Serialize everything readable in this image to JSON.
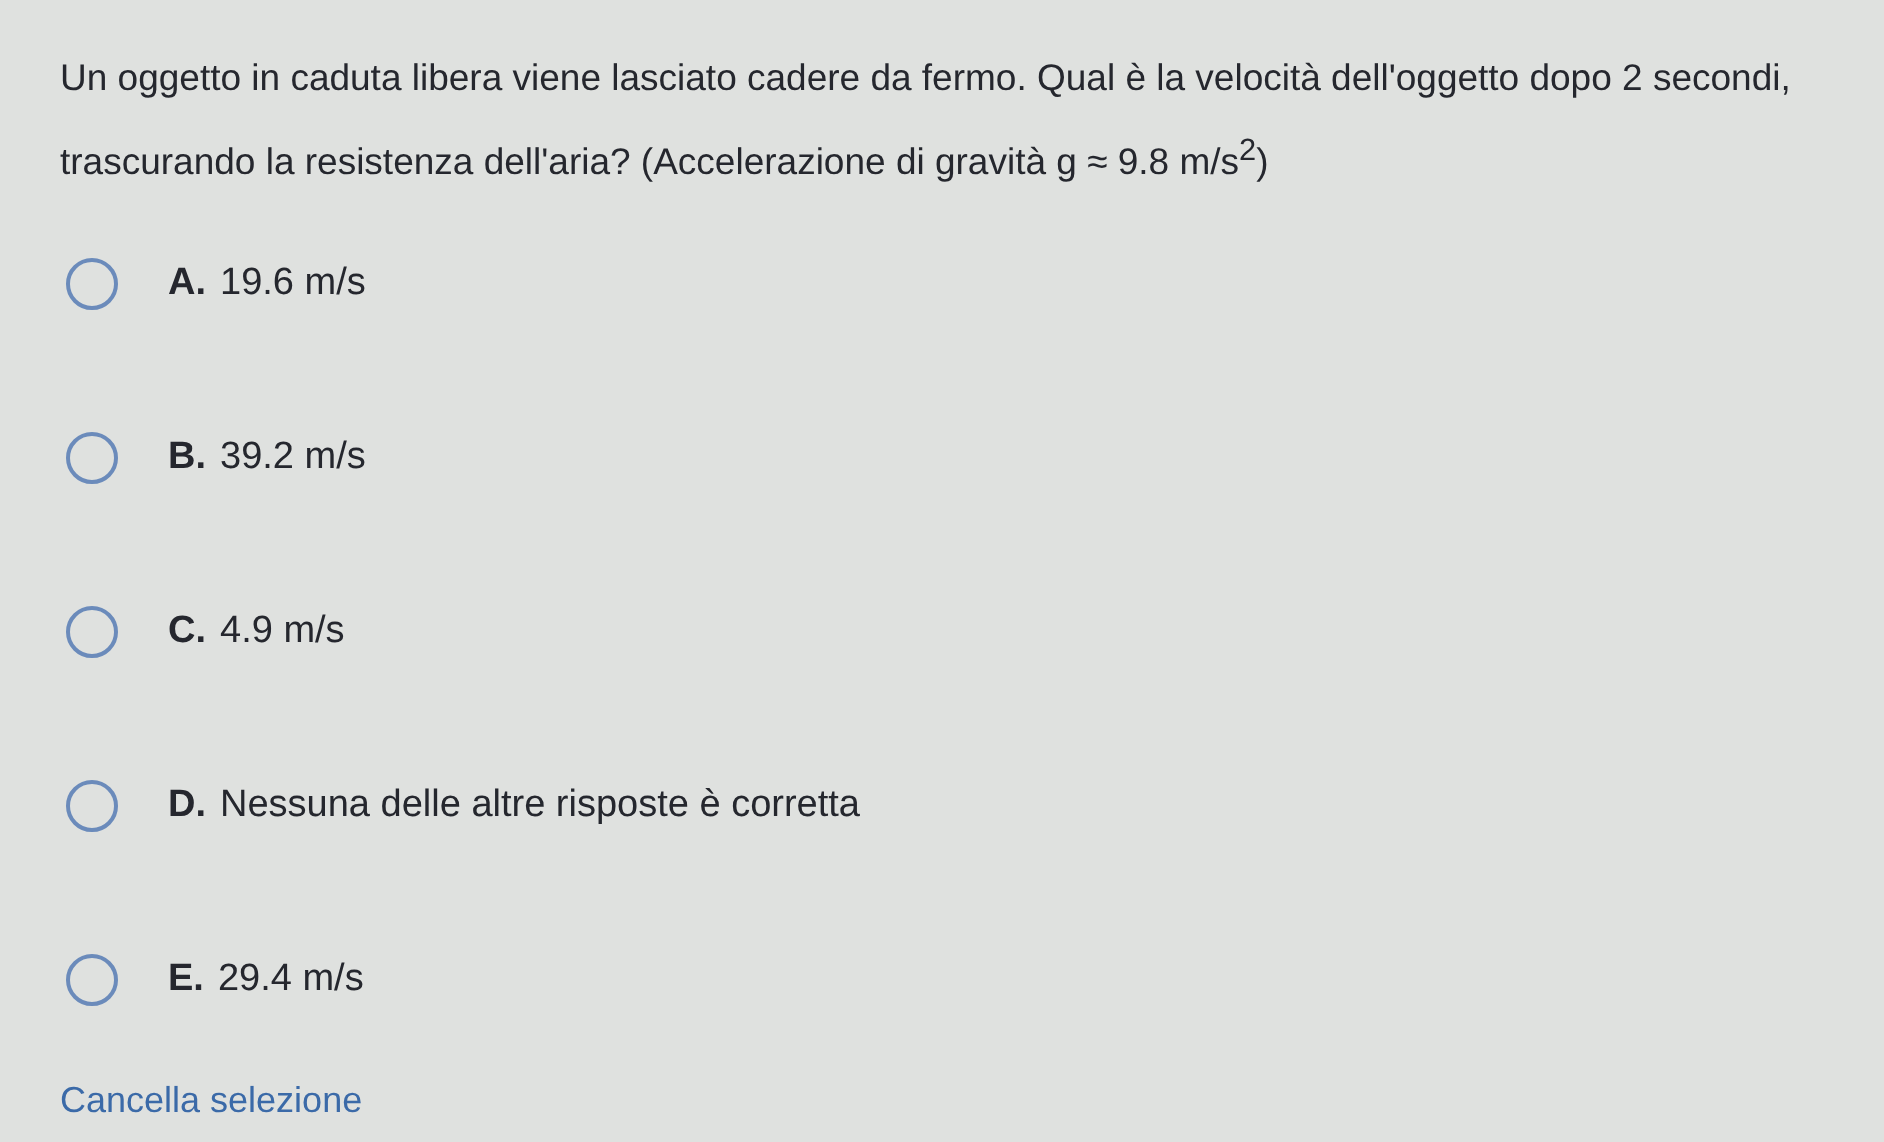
{
  "question": "Un oggetto in caduta libera viene lasciato cadere da fermo. Qual è la velocità dell'oggetto dopo 2 secondi, trascurando la resistenza dell'aria? (Accelerazione di gravità g ≈ 9.8 m/s$^{2}$)",
  "options": [
    {
      "letter": "A.",
      "text": "19.6 m/s",
      "selected": false
    },
    {
      "letter": "B.",
      "text": "39.2 m/s",
      "selected": false
    },
    {
      "letter": "C.",
      "text": "4.9 m/s",
      "selected": false
    },
    {
      "letter": "D.",
      "text": "Nessuna delle altre risposte è corretta",
      "selected": false
    },
    {
      "letter": "E.",
      "text": "29.4 m/s",
      "selected": false
    }
  ],
  "clear_link": "Cancella selezione"
}
